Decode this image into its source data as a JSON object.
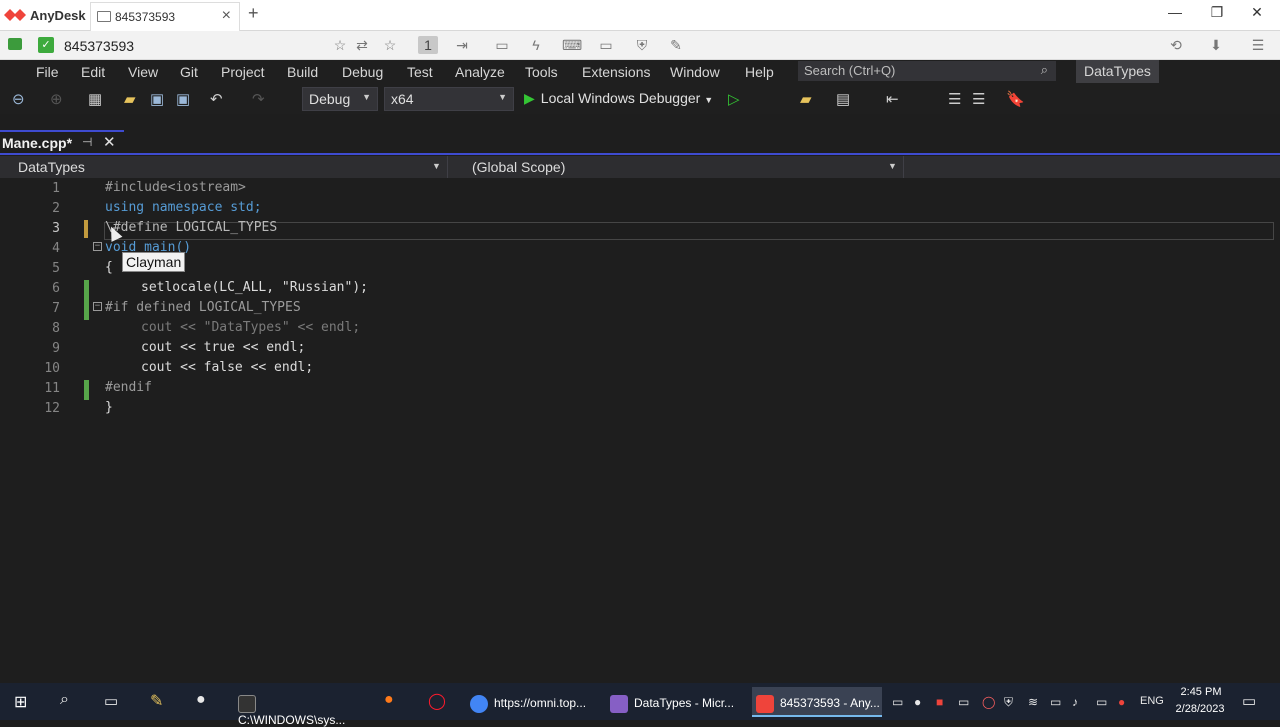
{
  "anydesk": {
    "app_name": "AnyDesk",
    "tab_label": "845373593",
    "address_value": "845373593",
    "window_controls": [
      "—",
      "❐",
      "✕"
    ]
  },
  "vs": {
    "menu": [
      "File",
      "Edit",
      "View",
      "Git",
      "Project",
      "Build",
      "Debug",
      "Test",
      "Analyze",
      "Tools",
      "Extensions",
      "Window",
      "Help"
    ],
    "search_placeholder": "Search (Ctrl+Q)",
    "solution_name": "DataTypes",
    "config": "Debug",
    "platform": "x64",
    "debugger": "Local Windows Debugger",
    "document_tab": "Mane.cpp*",
    "nav_project": "DataTypes",
    "nav_scope": "(Global Scope)",
    "tooltip": "Clayman",
    "code_lines": [
      {
        "n": "1",
        "t": "#include<iostream>"
      },
      {
        "n": "2",
        "t": "using namespace std;"
      },
      {
        "n": "3",
        "t": "\\#define LOGICAL_TYPES"
      },
      {
        "n": "4",
        "t": "void main()"
      },
      {
        "n": "5",
        "t": "{"
      },
      {
        "n": "6",
        "t": "setlocale(LC_ALL, \"Russian\");"
      },
      {
        "n": "7",
        "t": "#if defined LOGICAL_TYPES"
      },
      {
        "n": "8",
        "t": "cout << \"DataTypes\" << endl;"
      },
      {
        "n": "9",
        "t": "cout << true << endl;"
      },
      {
        "n": "10",
        "t": "cout << false << endl;"
      },
      {
        "n": "11",
        "t": "#endif"
      },
      {
        "n": "12",
        "t": "}"
      }
    ]
  },
  "taskbar": {
    "apps": [
      {
        "label": "C:\\WINDOWS\\sys...",
        "color": "#333333"
      },
      {
        "label": "https://omni.top...",
        "color": "#4285f4"
      },
      {
        "label": "DataTypes - Micr...",
        "color": "#865fc5"
      },
      {
        "label": "845373593 - Any...",
        "color": "#ef443b"
      }
    ],
    "lang": "ENG",
    "time": "2:45 PM",
    "date": "2/28/2023"
  }
}
